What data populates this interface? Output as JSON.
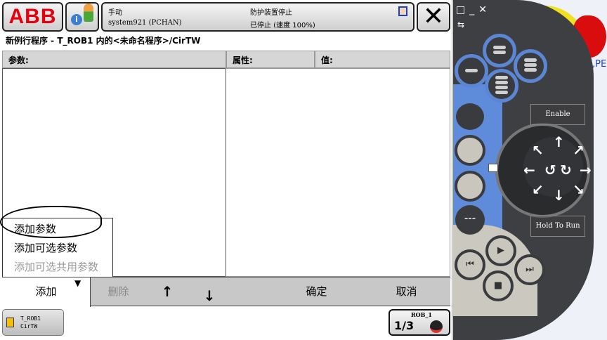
{
  "header": {
    "logo": "ABB",
    "mode": "手动",
    "system": "system921 (PCHAN)",
    "safety": "防护装置停止",
    "state": "已停止 (速度 100%)"
  },
  "title": "新例行程序 - T_ROB1 内的<未命名程序>/CirTW",
  "table": {
    "col_params": "参数:",
    "col_attr": "属性:",
    "col_value": "值:"
  },
  "add_menu": {
    "items": [
      "添加参数",
      "添加可选参数",
      "添加可选共用参数"
    ]
  },
  "toolbar": {
    "add": "添加",
    "delete": "删除",
    "up": "↑",
    "down": "↓",
    "ok": "确定",
    "cancel": "取消"
  },
  "taskbar": {
    "task_line1": "T_ROB1",
    "task_line2": "CirTW",
    "rob": "ROB_1",
    "rob_fraction": "1/3"
  },
  "pendant": {
    "enable": "Enable",
    "hold_to_run": "Hold To Run",
    "background_text": ",PEI"
  }
}
